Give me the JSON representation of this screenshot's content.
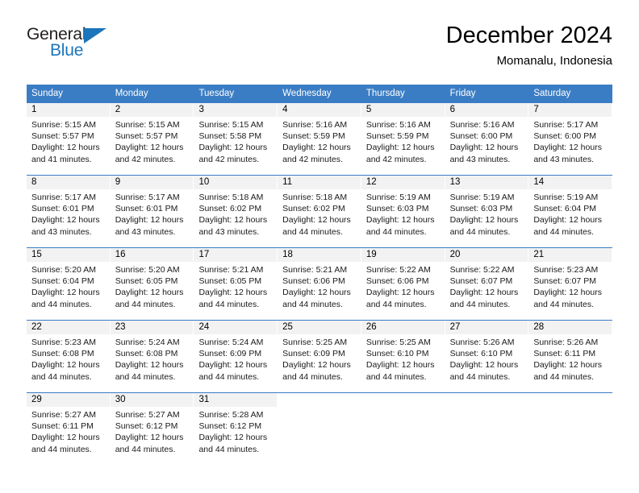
{
  "logo": {
    "text_top": "General",
    "text_bottom": "Blue",
    "accent_color": "#1b75bb",
    "triangle_icon": "triangle-icon"
  },
  "header": {
    "title": "December 2024",
    "subtitle": "Momanalu, Indonesia"
  },
  "theme": {
    "header_bar_color": "#3b7dc4",
    "day_band_color": "#f2f2f2",
    "text_color": "#000000"
  },
  "weekdays": [
    "Sunday",
    "Monday",
    "Tuesday",
    "Wednesday",
    "Thursday",
    "Friday",
    "Saturday"
  ],
  "weeks": [
    [
      {
        "day": "1",
        "sunrise": "Sunrise: 5:15 AM",
        "sunset": "Sunset: 5:57 PM",
        "daylight": "Daylight: 12 hours and 41 minutes."
      },
      {
        "day": "2",
        "sunrise": "Sunrise: 5:15 AM",
        "sunset": "Sunset: 5:57 PM",
        "daylight": "Daylight: 12 hours and 42 minutes."
      },
      {
        "day": "3",
        "sunrise": "Sunrise: 5:15 AM",
        "sunset": "Sunset: 5:58 PM",
        "daylight": "Daylight: 12 hours and 42 minutes."
      },
      {
        "day": "4",
        "sunrise": "Sunrise: 5:16 AM",
        "sunset": "Sunset: 5:59 PM",
        "daylight": "Daylight: 12 hours and 42 minutes."
      },
      {
        "day": "5",
        "sunrise": "Sunrise: 5:16 AM",
        "sunset": "Sunset: 5:59 PM",
        "daylight": "Daylight: 12 hours and 42 minutes."
      },
      {
        "day": "6",
        "sunrise": "Sunrise: 5:16 AM",
        "sunset": "Sunset: 6:00 PM",
        "daylight": "Daylight: 12 hours and 43 minutes."
      },
      {
        "day": "7",
        "sunrise": "Sunrise: 5:17 AM",
        "sunset": "Sunset: 6:00 PM",
        "daylight": "Daylight: 12 hours and 43 minutes."
      }
    ],
    [
      {
        "day": "8",
        "sunrise": "Sunrise: 5:17 AM",
        "sunset": "Sunset: 6:01 PM",
        "daylight": "Daylight: 12 hours and 43 minutes."
      },
      {
        "day": "9",
        "sunrise": "Sunrise: 5:17 AM",
        "sunset": "Sunset: 6:01 PM",
        "daylight": "Daylight: 12 hours and 43 minutes."
      },
      {
        "day": "10",
        "sunrise": "Sunrise: 5:18 AM",
        "sunset": "Sunset: 6:02 PM",
        "daylight": "Daylight: 12 hours and 43 minutes."
      },
      {
        "day": "11",
        "sunrise": "Sunrise: 5:18 AM",
        "sunset": "Sunset: 6:02 PM",
        "daylight": "Daylight: 12 hours and 44 minutes."
      },
      {
        "day": "12",
        "sunrise": "Sunrise: 5:19 AM",
        "sunset": "Sunset: 6:03 PM",
        "daylight": "Daylight: 12 hours and 44 minutes."
      },
      {
        "day": "13",
        "sunrise": "Sunrise: 5:19 AM",
        "sunset": "Sunset: 6:03 PM",
        "daylight": "Daylight: 12 hours and 44 minutes."
      },
      {
        "day": "14",
        "sunrise": "Sunrise: 5:19 AM",
        "sunset": "Sunset: 6:04 PM",
        "daylight": "Daylight: 12 hours and 44 minutes."
      }
    ],
    [
      {
        "day": "15",
        "sunrise": "Sunrise: 5:20 AM",
        "sunset": "Sunset: 6:04 PM",
        "daylight": "Daylight: 12 hours and 44 minutes."
      },
      {
        "day": "16",
        "sunrise": "Sunrise: 5:20 AM",
        "sunset": "Sunset: 6:05 PM",
        "daylight": "Daylight: 12 hours and 44 minutes."
      },
      {
        "day": "17",
        "sunrise": "Sunrise: 5:21 AM",
        "sunset": "Sunset: 6:05 PM",
        "daylight": "Daylight: 12 hours and 44 minutes."
      },
      {
        "day": "18",
        "sunrise": "Sunrise: 5:21 AM",
        "sunset": "Sunset: 6:06 PM",
        "daylight": "Daylight: 12 hours and 44 minutes."
      },
      {
        "day": "19",
        "sunrise": "Sunrise: 5:22 AM",
        "sunset": "Sunset: 6:06 PM",
        "daylight": "Daylight: 12 hours and 44 minutes."
      },
      {
        "day": "20",
        "sunrise": "Sunrise: 5:22 AM",
        "sunset": "Sunset: 6:07 PM",
        "daylight": "Daylight: 12 hours and 44 minutes."
      },
      {
        "day": "21",
        "sunrise": "Sunrise: 5:23 AM",
        "sunset": "Sunset: 6:07 PM",
        "daylight": "Daylight: 12 hours and 44 minutes."
      }
    ],
    [
      {
        "day": "22",
        "sunrise": "Sunrise: 5:23 AM",
        "sunset": "Sunset: 6:08 PM",
        "daylight": "Daylight: 12 hours and 44 minutes."
      },
      {
        "day": "23",
        "sunrise": "Sunrise: 5:24 AM",
        "sunset": "Sunset: 6:08 PM",
        "daylight": "Daylight: 12 hours and 44 minutes."
      },
      {
        "day": "24",
        "sunrise": "Sunrise: 5:24 AM",
        "sunset": "Sunset: 6:09 PM",
        "daylight": "Daylight: 12 hours and 44 minutes."
      },
      {
        "day": "25",
        "sunrise": "Sunrise: 5:25 AM",
        "sunset": "Sunset: 6:09 PM",
        "daylight": "Daylight: 12 hours and 44 minutes."
      },
      {
        "day": "26",
        "sunrise": "Sunrise: 5:25 AM",
        "sunset": "Sunset: 6:10 PM",
        "daylight": "Daylight: 12 hours and 44 minutes."
      },
      {
        "day": "27",
        "sunrise": "Sunrise: 5:26 AM",
        "sunset": "Sunset: 6:10 PM",
        "daylight": "Daylight: 12 hours and 44 minutes."
      },
      {
        "day": "28",
        "sunrise": "Sunrise: 5:26 AM",
        "sunset": "Sunset: 6:11 PM",
        "daylight": "Daylight: 12 hours and 44 minutes."
      }
    ],
    [
      {
        "day": "29",
        "sunrise": "Sunrise: 5:27 AM",
        "sunset": "Sunset: 6:11 PM",
        "daylight": "Daylight: 12 hours and 44 minutes."
      },
      {
        "day": "30",
        "sunrise": "Sunrise: 5:27 AM",
        "sunset": "Sunset: 6:12 PM",
        "daylight": "Daylight: 12 hours and 44 minutes."
      },
      {
        "day": "31",
        "sunrise": "Sunrise: 5:28 AM",
        "sunset": "Sunset: 6:12 PM",
        "daylight": "Daylight: 12 hours and 44 minutes."
      },
      {
        "day": "",
        "sunrise": "",
        "sunset": "",
        "daylight": ""
      },
      {
        "day": "",
        "sunrise": "",
        "sunset": "",
        "daylight": ""
      },
      {
        "day": "",
        "sunrise": "",
        "sunset": "",
        "daylight": ""
      },
      {
        "day": "",
        "sunrise": "",
        "sunset": "",
        "daylight": ""
      }
    ]
  ]
}
